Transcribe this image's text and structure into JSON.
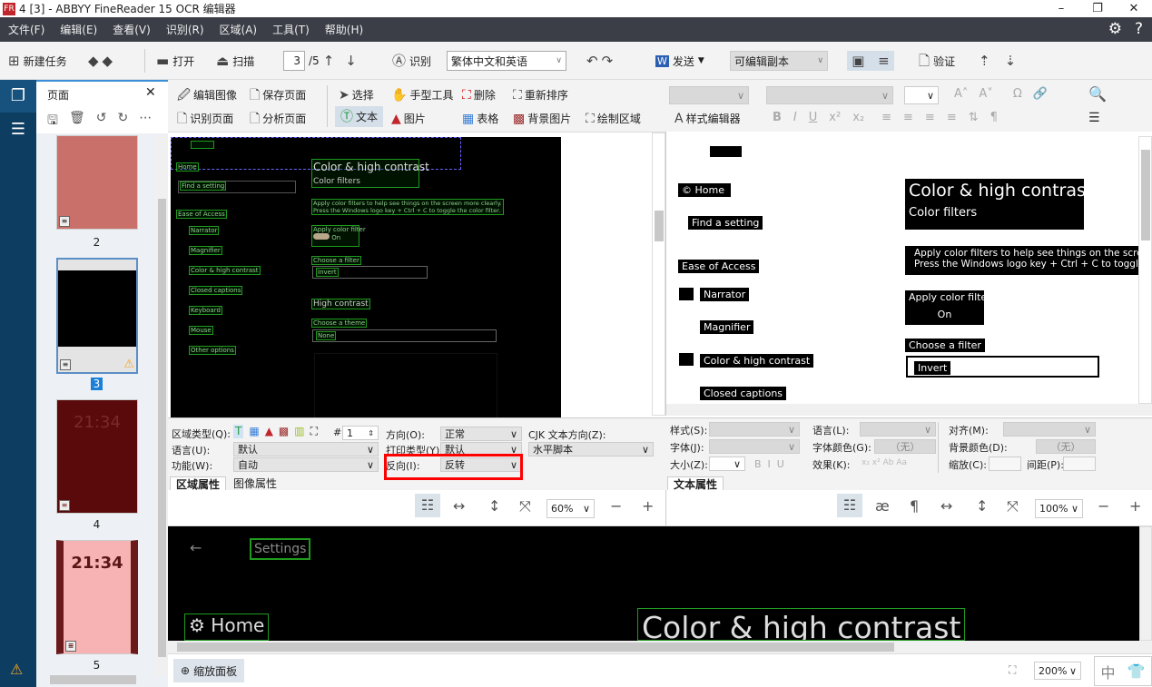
{
  "window": {
    "title": "4 [3] - ABBYY FineReader 15 OCR 编辑器",
    "logo": "FR"
  },
  "menu": [
    "文件(F)",
    "编辑(E)",
    "查看(V)",
    "识别(R)",
    "区域(A)",
    "工具(T)",
    "帮助(H)"
  ],
  "toolbar": {
    "new_task": "新建任务",
    "open": "打开",
    "scan": "扫描",
    "page_current": "3",
    "page_total": "/5",
    "recognize": "识别",
    "language": "繁体中文和英语",
    "send": "发送",
    "send_target": "可编辑副本",
    "verify": "验证"
  },
  "pages_panel": {
    "title": "页面",
    "thumbnails": [
      {
        "num": "2",
        "color": "#c9706b"
      },
      {
        "num": "3",
        "selected": true,
        "warning": true
      },
      {
        "num": "4",
        "time": "21:34",
        "color": "#5a0a0a"
      },
      {
        "num": "5",
        "time": "21:34",
        "color": "#f7b3b3"
      }
    ]
  },
  "image_tools": {
    "edit_image": "编辑图像",
    "save_page": "保存页面",
    "recognize_page": "识别页面",
    "analyze_page": "分析页面",
    "select": "选择",
    "hand": "手型工具",
    "delete": "删除",
    "reorder": "重新排序",
    "text": "文本",
    "picture": "图片",
    "table": "表格",
    "bg_picture": "背景图片",
    "draw_area": "绘制区域"
  },
  "text_tools": {
    "style_editor": "样式编辑器"
  },
  "image": {
    "home": "Home",
    "find": "Find a setting",
    "ease": "Ease of Access",
    "nav": [
      "Narrator",
      "Magnifier",
      "Color & high contrast",
      "Closed captions",
      "Keyboard",
      "Mouse",
      "Other options"
    ],
    "heading": "Color & high contrast",
    "sub": "Color filters",
    "desc1": "Apply color filters to help see things on the screen more clearly.",
    "desc2": "Press the Windows logo key + Ctrl + C to toggle the color filter.",
    "apply": "Apply color filter",
    "on": "On",
    "choose_filter": "Choose a filter",
    "filter": "Invert",
    "high_contrast": "High contrast",
    "choose_theme": "Choose a theme",
    "theme": "None"
  },
  "area_props": {
    "type_label": "区域类型(Q):",
    "num_label": "#",
    "num": "1",
    "orient_label": "方向(O):",
    "orient": "正常",
    "cjk_label": "CJK 文本方向(Z):",
    "cjk": "水平脚本",
    "lang_label": "语言(U):",
    "lang": "默认",
    "print_label": "打印类型(Y):",
    "print": "默认",
    "func_label": "功能(W):",
    "func": "自动",
    "invert_label": "反向(I):",
    "invert": "反转",
    "tabs": [
      "区域属性",
      "图像属性"
    ]
  },
  "text_props": {
    "style": "样式(S):",
    "font": "字体(J):",
    "size": "大小(Z):",
    "language": "语言(L):",
    "font_color": "字体颜色(G):",
    "font_color_val": "（无）",
    "effect": "效果(K):",
    "align": "对齐(M):",
    "bg_color": "背景颜色(D):",
    "bg_color_val": "（无）",
    "scale": "缩放(C):",
    "spacing": "间距(P):",
    "tab": "文本属性"
  },
  "image_zoom": "60%",
  "text_zoom": "100%",
  "text_view": {
    "home": "© Home",
    "find": "Find a setting",
    "ease": "Ease of Access",
    "narrator": "Narrator",
    "magnifier": "Magnifier",
    "color": "Color & high contrast",
    "captions": "Closed captions",
    "heading": "Color & high contrast",
    "sub": "Color filters",
    "desc1": "Apply color filters to help see things on the screen m",
    "desc2": "Press the Windows logo key + Ctrl + C to toggle the",
    "apply": "Apply color filter",
    "on": "On",
    "choose": "Choose a filter",
    "invert": "Invert"
  },
  "zoom_view": {
    "settings": "Settings",
    "home": "Home",
    "heading": "Color & high contrast"
  },
  "status": {
    "zoom_panel": "缩放面板",
    "zoom": "200%",
    "ime": "中"
  }
}
